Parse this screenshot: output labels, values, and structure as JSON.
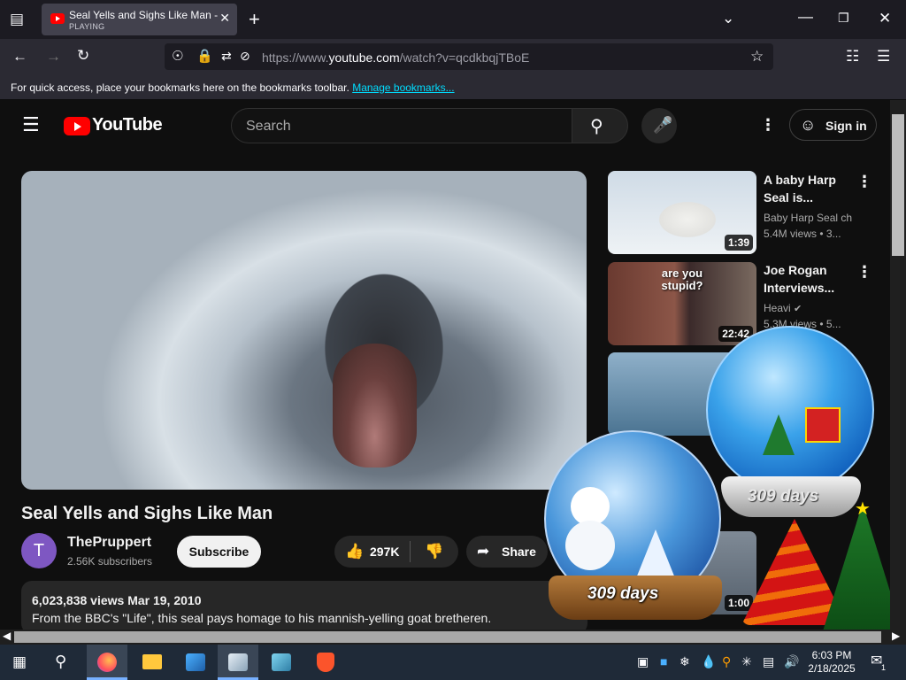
{
  "browser": {
    "tab": {
      "title": "Seal Yells and Sighs Like Man -",
      "status": "PLAYING"
    },
    "url": {
      "prefix": "https://www.",
      "domain": "youtube.com",
      "path": "/watch?v=qcdkbqjTBoE"
    },
    "bookmarks_bar": {
      "message": "For quick access, place your bookmarks here on the bookmarks toolbar.",
      "link": "Manage bookmarks..."
    }
  },
  "youtube": {
    "logo_text": "YouTube",
    "search_placeholder": "Search",
    "sign_in": "Sign in",
    "video": {
      "title": "Seal Yells and Sighs Like Man",
      "channel": "ThePruppert",
      "avatar_letter": "T",
      "subscribers": "2.56K subscribers",
      "subscribe": "Subscribe",
      "likes": "297K",
      "share": "Share",
      "views_date": "6,023,838 views  Mar 19, 2010",
      "description": "From the BBC's \"Life\", this seal pays homage to his mannish-yelling goat bretheren."
    },
    "related": [
      {
        "title": "A baby Harp Seal is...",
        "channel": "Baby Harp Seal ch",
        "meta": "5.4M views  • 3...",
        "duration": "1:39"
      },
      {
        "title": "Joe Rogan Interviews...",
        "channel": "Heavi",
        "meta": "5.3M views  • 5...",
        "duration": "22:42",
        "overlay_text": "are you stupid?"
      },
      {
        "title": "",
        "channel": "",
        "meta": "",
        "duration": "1:00"
      }
    ]
  },
  "widgets": {
    "countdown_1": "309 days",
    "countdown_2": "309 days"
  },
  "taskbar": {
    "time": "6:03 PM",
    "date": "2/18/2025",
    "notif_count": "1"
  },
  "colors": {
    "yt_red": "#ff0000",
    "bg": "#0f0f0f",
    "browser_dark": "#1c1b22",
    "link": "#00ddff"
  }
}
